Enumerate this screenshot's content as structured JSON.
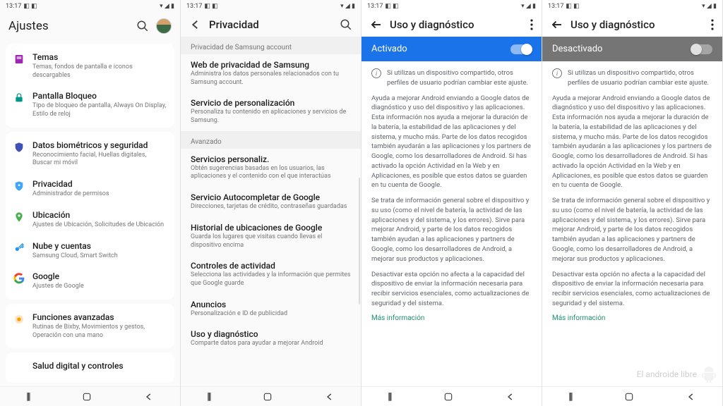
{
  "status": {
    "time": "13:17",
    "icons_left": "◧ ◧",
    "icons_right": "▾ ◢ ▮"
  },
  "panel1": {
    "title": "Ajustes",
    "groups": [
      {
        "items": [
          {
            "icon": "themes",
            "color": "#9c27b0",
            "title": "Temas",
            "sub": "Temas, fondos de pantalla e iconos descargables"
          },
          {
            "icon": "lock",
            "color": "#009688",
            "title": "Pantalla Bloqueo",
            "sub": "Tipo de bloqueo de pantalla, Always On Display, Estilo de reloj"
          }
        ]
      },
      {
        "items": [
          {
            "icon": "shield",
            "color": "#3f51b5",
            "title": "Datos biométricos y seguridad",
            "sub": "Reconocimiento facial, Huellas digitales, Buscar mi móvil"
          },
          {
            "icon": "shield2",
            "color": "#42a5f5",
            "title": "Privacidad",
            "sub": "Administrador de permisos"
          },
          {
            "icon": "pin",
            "color": "#4caf50",
            "title": "Ubicación",
            "sub": "Ajustes de Ubicación, Solicitudes de Ubicación"
          },
          {
            "icon": "key",
            "color": "#2196f3",
            "title": "Nube y cuentas",
            "sub": "Samsung Cloud, Smart Switch"
          },
          {
            "icon": "google",
            "color": "#4285f4",
            "title": "Google",
            "sub": "Ajustes de Google"
          }
        ]
      },
      {
        "items": [
          {
            "icon": "advanced",
            "color": "#ff9800",
            "title": "Funciones avanzadas",
            "sub": "Rutinas de Bixby, Movimientos y gestos, Operación con una mano"
          }
        ]
      },
      {
        "items": [
          {
            "icon": "",
            "color": "",
            "title": "Salud digital y controles",
            "sub": ""
          }
        ]
      }
    ]
  },
  "panel2": {
    "title": "Privacidad",
    "sections": [
      {
        "label": "Privacidad de Samsung account",
        "items": [
          {
            "title": "Web de privacidad de Samsung",
            "sub": "Administra los datos personales relacionados con tu Samsung account."
          },
          {
            "title": "Servicio de personalización",
            "sub": "Personaliza tu contenido en aplicaciones y servicios de Samsung."
          }
        ]
      },
      {
        "label": "Avanzado",
        "items": [
          {
            "title": "Servicios personaliz.",
            "sub": "Obtén sugerencias basadas en los usuarios, las aplicaciones y el contenido con el que interactúas"
          },
          {
            "title": "Servicio Autocompletar de Google",
            "sub": "Direcciones, tarjetas de crédito, contraseñas guardadas"
          },
          {
            "title": "Historial de ubicaciones de Google",
            "sub": "Guarda los lugares que visitas cuando llevas el dispositivo encima"
          },
          {
            "title": "Controles de actividad",
            "sub": "Selecciona las actividades y la información que permites que Google guarde"
          },
          {
            "title": "Anuncios",
            "sub": "Personalización e ID de publicidad"
          },
          {
            "title": "Uso y diagnóstico",
            "sub": "Comparte datos para ayudar a mejorar Android"
          }
        ]
      }
    ]
  },
  "panel3": {
    "title": "Uso y diagnóstico",
    "toggle_label": "Activado",
    "toggle_state": "on",
    "info": "Si utilizas un dispositivo compartido, otros perfiles de usuario podrían cambiar este ajuste.",
    "p1": "Ayuda a mejorar Android enviando a Google datos de diagnóstico y uso del dispositivo y las aplicaciones. Esta información nos ayuda a mejorar la duración de la batería, la estabilidad de las aplicaciones y del sistema, y mucho más. Parte de los datos recogidos también ayudarán a las aplicaciones y los partners de Google, como los desarrolladores de Android. Si has activado la opción Actividad en la Web y en Aplicaciones, es posible que estos datos se guarden en tu cuenta de Google.",
    "p2": "Se trata de información general sobre el dispositivo y su uso (como el nivel de batería, la actividad de las aplicaciones y del sistema, y los errores). Sirve para mejorar Android, y parte de los datos recogidos también ayudan a las aplicaciones y partners de Google, como los desarrolladores de Android, a mejorar sus productos y aplicaciones.",
    "p3": "Desactivar esta opción no afecta a la capacidad del dispositivo de enviar la información necesaria para recibir servicios esenciales, como actualizaciones de seguridad y del sistema.",
    "link": "Más información"
  },
  "panel4": {
    "title": "Uso y diagnóstico",
    "toggle_label": "Desactivado",
    "toggle_state": "off",
    "info": "Si utilizas un dispositivo compartido, otros perfiles de usuario podrían cambiar este ajuste.",
    "p1": "Ayuda a mejorar Android enviando a Google datos de diagnóstico y uso del dispositivo y las aplicaciones. Esta información nos ayuda a mejorar la duración de la batería, la estabilidad de las aplicaciones y del sistema, y mucho más. Parte de los datos recogidos también ayudarán a las aplicaciones y los partners de Google, como los desarrolladores de Android. Si has activado la opción Actividad en la Web y en Aplicaciones, es posible que estos datos se guarden en tu cuenta de Google.",
    "p2": "Se trata de información general sobre el dispositivo y su uso (como el nivel de batería, la actividad de las aplicaciones y del sistema, y los errores). Sirve para mejorar Android, y parte de los datos recogidos también ayudan a las aplicaciones y partners de Google, como los desarrolladores de Android, a mejorar sus productos y aplicaciones.",
    "p3": "Desactivar esta opción no afecta a la capacidad del dispositivo de enviar la información necesaria para recibir servicios esenciales, como actualizaciones de seguridad y del sistema.",
    "link": "Más información",
    "watermark": "El androide libre"
  },
  "nav": {
    "recent": "|||",
    "home": "◯",
    "back": "‹"
  }
}
